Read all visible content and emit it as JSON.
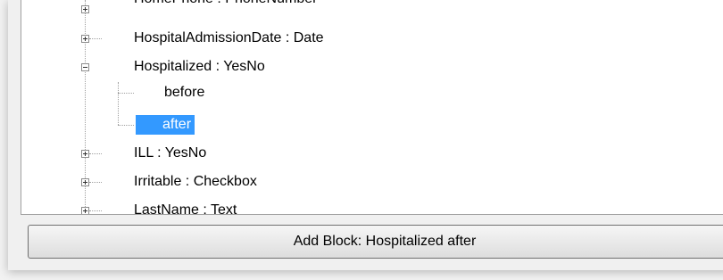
{
  "tree": {
    "nodes": [
      {
        "label": "HomePhone : PhoneNumber"
      },
      {
        "label": "HospitalAdmissionDate : Date"
      },
      {
        "label": "Hospitalized : YesNo"
      },
      {
        "label": "before"
      },
      {
        "label": "after"
      },
      {
        "label": "ILL : YesNo"
      },
      {
        "label": "Irritable : Checkbox"
      },
      {
        "label": "LastName : Text"
      }
    ]
  },
  "button": {
    "label": "Add Block: Hospitalized after"
  },
  "colors": {
    "selection": "#3399ff",
    "tree_background": "#ffffff",
    "window_background": "#f0f0f0"
  }
}
